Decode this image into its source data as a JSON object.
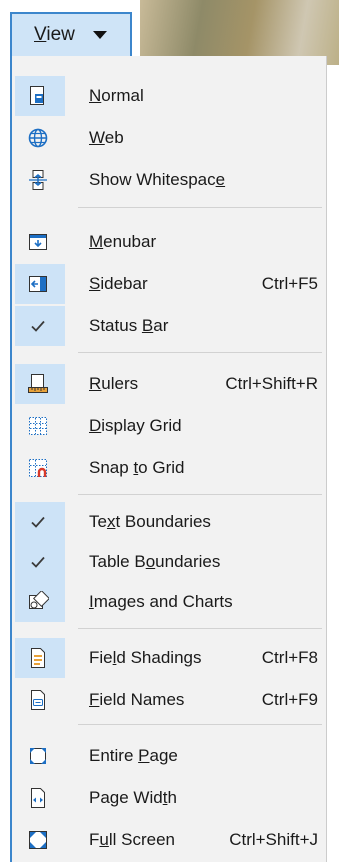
{
  "topbar": {
    "view_label": "View"
  },
  "menu": {
    "items": [
      {
        "label": "Normal",
        "mnemonic": 0,
        "shortcut": "",
        "icon": "normal-view-icon",
        "selected": true
      },
      {
        "label": "Web",
        "mnemonic": 0,
        "shortcut": "",
        "icon": "globe-icon",
        "selected": false
      },
      {
        "label": "Show Whitespace",
        "mnemonic": 14,
        "shortcut": "",
        "icon": "show-whitespace-icon",
        "selected": false
      },
      {
        "label": "Menubar",
        "mnemonic": 0,
        "shortcut": "",
        "icon": "menubar-icon",
        "selected": false
      },
      {
        "label": "Sidebar",
        "mnemonic": 0,
        "shortcut": "Ctrl+F5",
        "icon": "sidebar-icon",
        "selected": true
      },
      {
        "label": "Status Bar",
        "mnemonic": 7,
        "shortcut": "",
        "icon": "check-icon",
        "selected": true
      },
      {
        "label": "Rulers",
        "mnemonic": 0,
        "shortcut": "Ctrl+Shift+R",
        "icon": "ruler-icon",
        "selected": true
      },
      {
        "label": "Display Grid",
        "mnemonic": 0,
        "shortcut": "",
        "icon": "grid-icon",
        "selected": false
      },
      {
        "label": "Snap to Grid",
        "mnemonic": 5,
        "shortcut": "",
        "icon": "snap-grid-icon",
        "selected": false
      },
      {
        "label": "Text Boundaries",
        "mnemonic": 2,
        "shortcut": "",
        "icon": "check-icon",
        "selected": true
      },
      {
        "label": "Table Boundaries",
        "mnemonic": 7,
        "shortcut": "",
        "icon": "check-icon",
        "selected": true
      },
      {
        "label": "Images and Charts",
        "mnemonic": 0,
        "shortcut": "",
        "icon": "images-charts-icon",
        "selected": true
      },
      {
        "label": "Field Shadings",
        "mnemonic": 3,
        "shortcut": "Ctrl+F8",
        "icon": "field-shadings-icon",
        "selected": true
      },
      {
        "label": "Field Names",
        "mnemonic": 0,
        "shortcut": "Ctrl+F9",
        "icon": "field-names-icon",
        "selected": false
      },
      {
        "label": "Entire Page",
        "mnemonic": 7,
        "shortcut": "",
        "icon": "entire-page-icon",
        "selected": false
      },
      {
        "label": "Page Width",
        "mnemonic": 8,
        "shortcut": "",
        "icon": "page-width-icon",
        "selected": false
      },
      {
        "label": "Full Screen",
        "mnemonic": 1,
        "shortcut": "Ctrl+Shift+J",
        "icon": "full-screen-icon",
        "selected": false
      }
    ]
  },
  "colors": {
    "selection": "#cde3f7",
    "accent_border": "#3c86cc",
    "menu_background": "#f2f2f2",
    "icon_blue": "#1d6fc4",
    "icon_red": "#d83a2a",
    "icon_orange": "#e8a23a"
  }
}
